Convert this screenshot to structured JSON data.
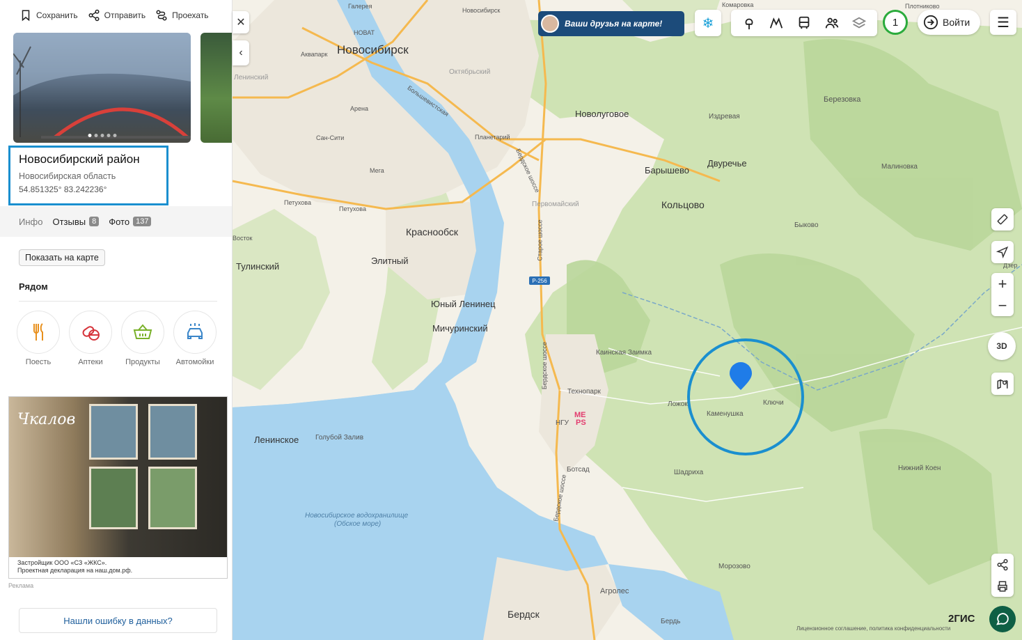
{
  "panel": {
    "actions": {
      "save": "Сохранить",
      "send": "Отправить",
      "route": "Проехать"
    },
    "title": "Новосибирский район",
    "region": "Новосибирская область",
    "coords": "54.851325° 83.242236°",
    "tabs": [
      {
        "label": "Инфо",
        "count": ""
      },
      {
        "label": "Отзывы",
        "count": "8"
      },
      {
        "label": "Фото",
        "count": "137"
      }
    ],
    "show_on_map": "Показать на карте",
    "nearby_title": "Рядом",
    "categories": [
      {
        "label": "Поесть",
        "icon": "fork-knife-icon"
      },
      {
        "label": "Аптеки",
        "icon": "pills-icon"
      },
      {
        "label": "Продукты",
        "icon": "basket-icon"
      },
      {
        "label": "Автомойки",
        "icon": "car-wash-icon"
      }
    ],
    "ad": {
      "logo": "Чкалов",
      "text1": "Застройщик ООО «СЗ «ЖКС».",
      "text2": "Проектная декларация на наш.дом.рф.",
      "label": "Реклама"
    },
    "error_button": "Нашли ошибку в данных?"
  },
  "map": {
    "close": "✕",
    "collapse": "‹",
    "promo": "Ваши друзья на карте!",
    "badge_count": "1",
    "login": "Войти",
    "zoom_in": "+",
    "zoom_out": "−",
    "view3d": "3D",
    "brand": "2ГИС",
    "license": "Лицензионное соглашение, политика конфиденциальности",
    "road_p256": "Р-256",
    "labels": {
      "novosibirsk": "Новосибирск",
      "krasnoobsk": "Краснообск",
      "koltsovo": "Кольцово",
      "berdsk": "Бердск",
      "elitny": "Элитный",
      "yuny_leninets": "Юный Ленинец",
      "michurinsky": "Мичуринский",
      "tulinsky": "Тулинский",
      "leninskoe": "Ленинское",
      "golubov_zaliv": "Голубой Залив",
      "novolugovoe": "Новолуговое",
      "baryshevo": "Барышево",
      "dvurechye": "Двуречье",
      "berezovka": "Березовка",
      "izdrevaya": "Издревая",
      "malinovka": "Малиновка",
      "bykovo": "Быково",
      "kainskaya": "Каинская Заимка",
      "tekhnopark": "Технопарк",
      "ngu": "НГУ",
      "botsad": "Ботсад",
      "kamenushka": "Каменушка",
      "klyuchi": "Ключи",
      "lozhok": "Ложок",
      "shadrikha": "Шадриха",
      "nizhny_koen": "Нижний Коен",
      "morozovo": "Морозово",
      "agroles": "Агролес",
      "berd_river": "Бердь",
      "reservoir": "Новосибирское водохранилище",
      "reservoir2": "(Обское море)",
      "pervomaisky": "Первомайский",
      "oktyabrsky": "Октябрьский",
      "leninsky": "Ленинский",
      "vostok": "Восток",
      "petukhova1": "Петухова",
      "petukhova2": "Петухова",
      "komarovka": "Комаровка",
      "plotnikovo": "Плотниково",
      "dzer": "Дзер",
      "galereya": "Галерея",
      "novat": "НОВАТ",
      "akvapark": "Аквапарк",
      "arena": "Арена",
      "san_siti": "Сан-Сити",
      "mega": "Мега",
      "planetary": "Планетарий",
      "novosibirsk_top": "Новосибирск",
      "bolshevistskaya": "Большевистская",
      "berdskoe1": "Бердское шоссе",
      "berdskoe2": "Бердское шоссе",
      "berdskoe3": "Бердское шоссе",
      "staroe": "Старое шоссе",
      "mels": "МЕ\nPS"
    }
  }
}
